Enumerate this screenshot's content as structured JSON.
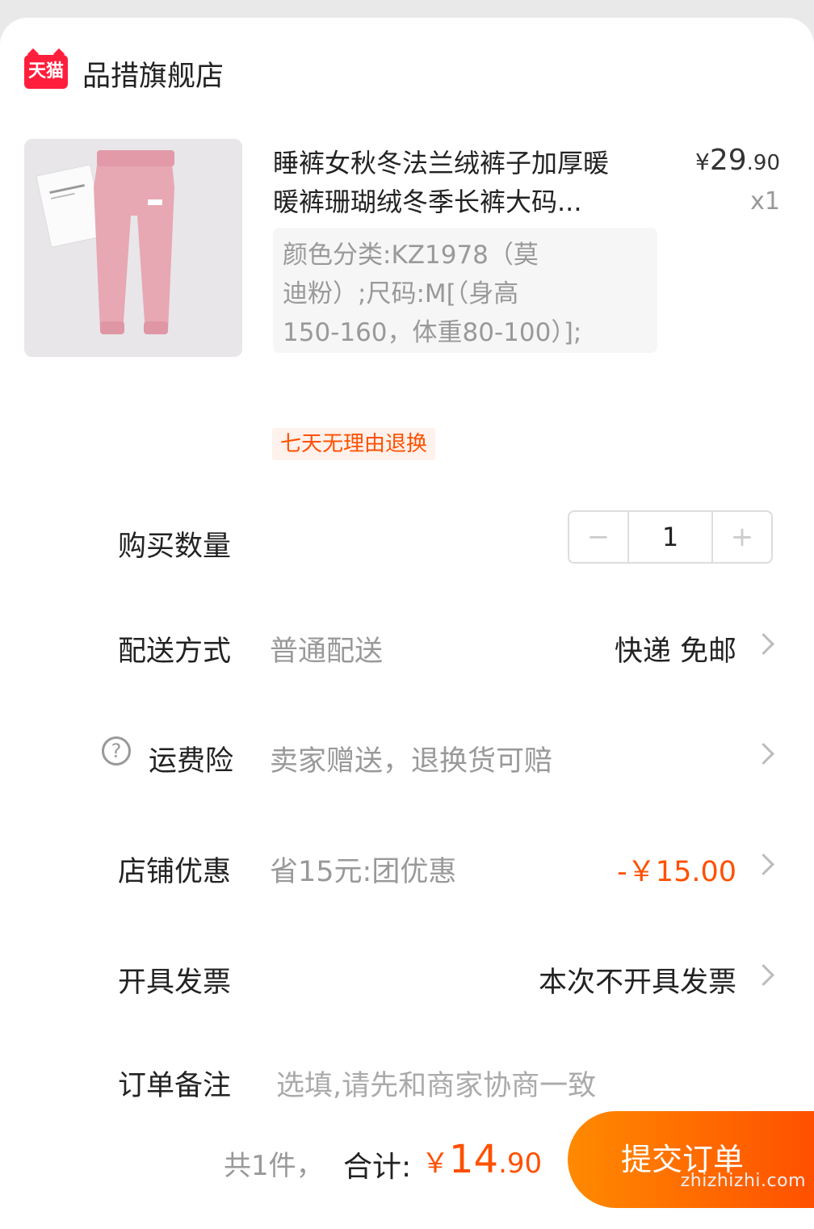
{
  "store": {
    "logo_text": "天猫",
    "name": "品措旗舰店"
  },
  "product": {
    "title_line1": "睡裤女秋冬法兰绒裤子加厚暖",
    "title_line2": "暖裤珊瑚绒冬季长裤大码...",
    "price_currency": "¥",
    "price_int": "29",
    "price_cents": ".90",
    "quantity_label": "x1",
    "sku_line1": "颜色分类:KZ1978（莫",
    "sku_line2": "迪粉）;尺码:M[（身高",
    "sku_line3": "150-160，体重80-100）];",
    "service_tag": "七天无理由退换"
  },
  "rows": {
    "quantity": {
      "label": "购买数量",
      "value": "1",
      "minus": "−",
      "plus": "+"
    },
    "delivery": {
      "label": "配送方式",
      "value": "普通配送",
      "right": "快递 免邮"
    },
    "insurance": {
      "label": "运费险",
      "value": "卖家赠送，退换货可赔",
      "icon": "?"
    },
    "discount": {
      "label": "店铺优惠",
      "value": "省15元:团优惠",
      "right": "-￥15.00"
    },
    "invoice": {
      "label": "开具发票",
      "right": "本次不开具发票"
    },
    "note": {
      "label": "订单备注",
      "placeholder": "选填,请先和商家协商一致"
    }
  },
  "bottom": {
    "count_text": "共1件，",
    "total_label": "合计:",
    "total_currency": "￥",
    "total_int": "14",
    "total_cents": ".90",
    "submit_label": "提交订单"
  },
  "watermark": "zhizhizhi.com",
  "colors": {
    "accent": "#ff5000",
    "tmall_red": "#ff1e3c"
  }
}
